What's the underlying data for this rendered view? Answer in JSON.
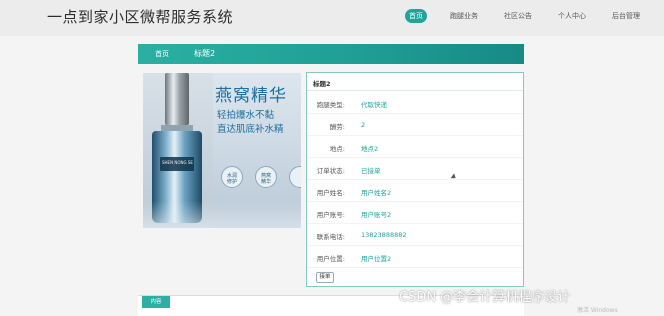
{
  "header": {
    "brand": "一点到家小区微帮服务系统",
    "nav": [
      {
        "label": "首页",
        "active": true
      },
      {
        "label": "跑腿业务",
        "active": false
      },
      {
        "label": "社区公告",
        "active": false
      },
      {
        "label": "个人中心",
        "active": false
      },
      {
        "label": "后台管理",
        "active": false
      }
    ]
  },
  "breadcrumb": {
    "home": "首页",
    "current": "标题2"
  },
  "product_image": {
    "title": "燕窝精华",
    "line1": "轻拍爆水不黏",
    "line2": "直达肌底补水精",
    "bottle_label": "SHEN NONG SE",
    "badges": [
      {
        "line1": "水润",
        "line2": "修护"
      },
      {
        "line1": "燕窝",
        "line2": "精华"
      }
    ]
  },
  "detail": {
    "title": "标题2",
    "rows": [
      {
        "label": "跑腿类型:",
        "value": "代取快递"
      },
      {
        "label": "酬劳:",
        "value": "2"
      },
      {
        "label": "地点:",
        "value": "地点2"
      },
      {
        "label": "订单状态:",
        "value": "已接单"
      },
      {
        "label": "用户姓名:",
        "value": "用户姓名2"
      },
      {
        "label": "用户账号:",
        "value": "用户账号2"
      },
      {
        "label": "联系电话:",
        "value": "13823888882"
      },
      {
        "label": "用户位置:",
        "value": "用户位置2"
      }
    ],
    "order_button": "接单"
  },
  "content_tab": {
    "label": "内容"
  },
  "watermark": "CSDN @李会计算机程序设计",
  "os_watermark": "激活 Windows",
  "colors": {
    "accent": "#1ea59a",
    "banner": "#1f9f96",
    "border": "#86c9bf"
  }
}
